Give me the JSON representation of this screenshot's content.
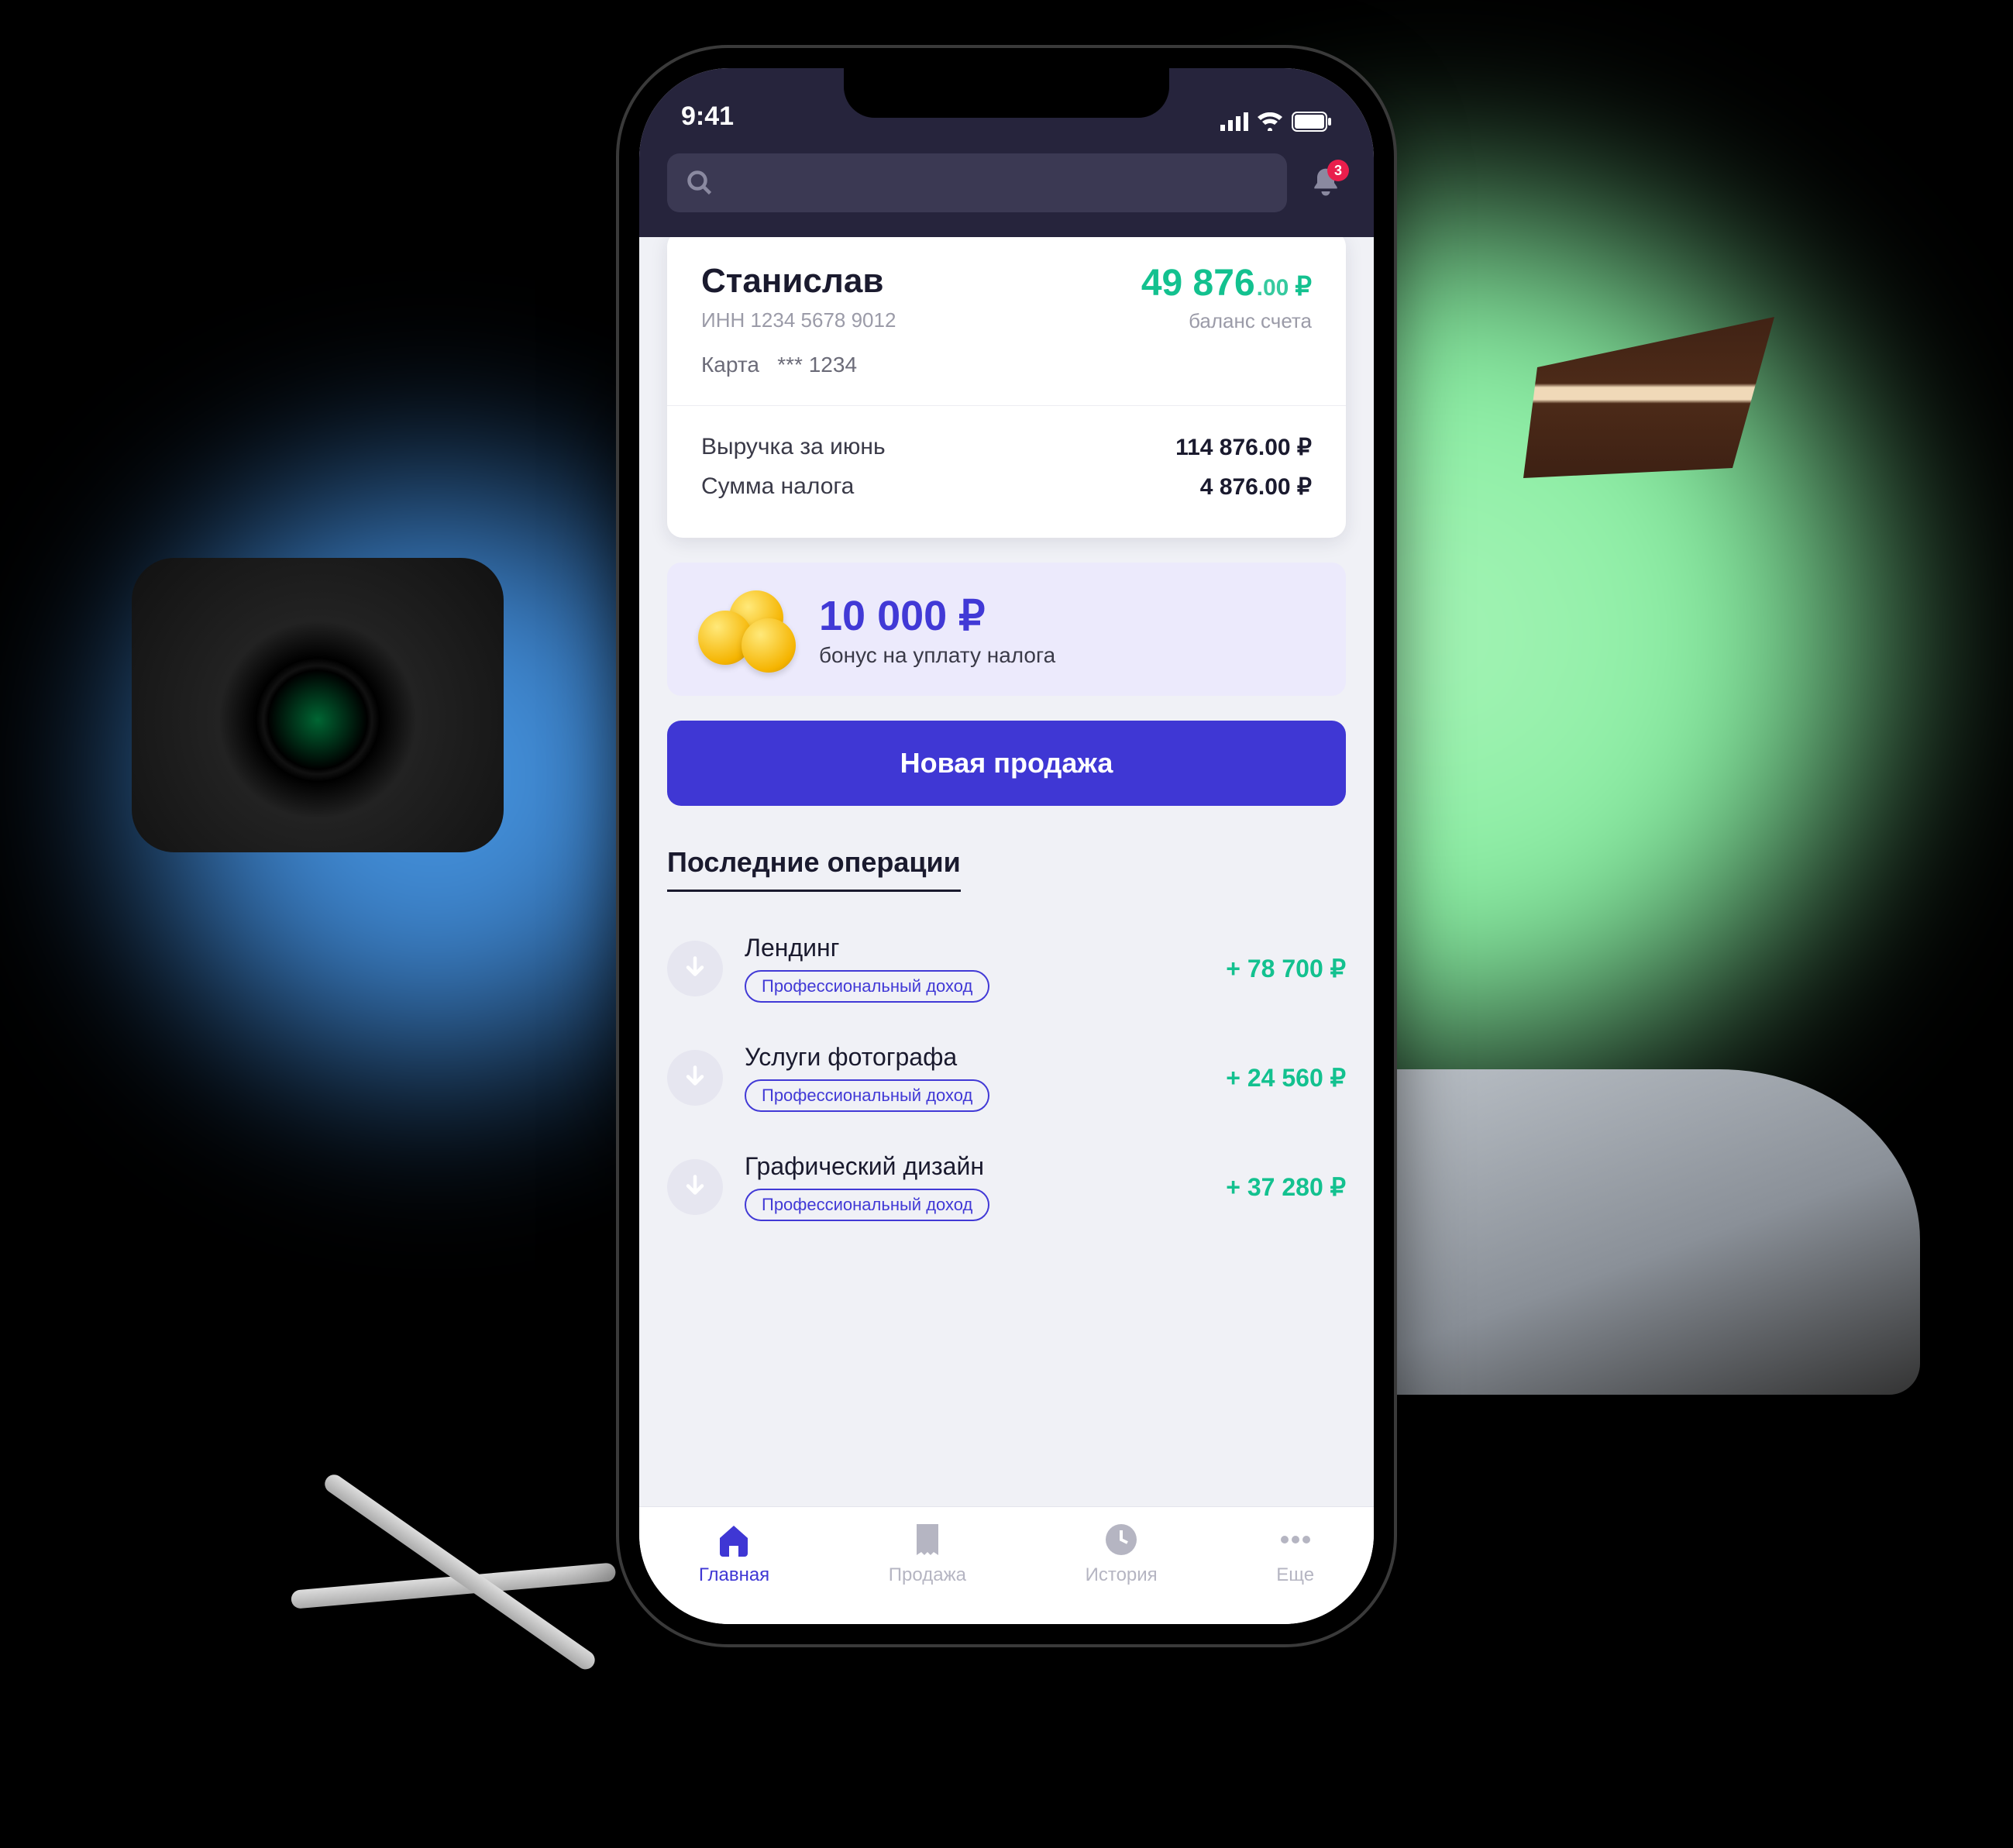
{
  "status": {
    "time": "9:41",
    "notif_count": "3"
  },
  "profile": {
    "name": "Станислав",
    "inn_label": "ИНН 1234 5678 9012",
    "card_label": "Карта",
    "card_mask": "*** 1234"
  },
  "balance": {
    "int": "49 876",
    "dec": ".00",
    "currency": "₽",
    "label": "баланс счета"
  },
  "stats": {
    "revenue_label": "Выручка за июнь",
    "revenue_value": "114 876.00 ₽",
    "tax_label": "Сумма налога",
    "tax_value": "4 876.00 ₽"
  },
  "bonus": {
    "amount": "10 000 ₽",
    "subtitle": "бонус на уплату налога"
  },
  "actions": {
    "new_sale": "Новая продажа"
  },
  "operations": {
    "title": "Последние операции",
    "tag": "Профессиональный доход",
    "items": [
      {
        "title": "Лендинг",
        "amount": "+ 78 700 ₽"
      },
      {
        "title": "Услуги фотографа",
        "amount": "+ 24 560 ₽"
      },
      {
        "title": "Графический дизайн",
        "amount": "+ 37 280 ₽"
      }
    ]
  },
  "tabs": {
    "home": "Главная",
    "sale": "Продажа",
    "history": "История",
    "more": "Еще"
  }
}
